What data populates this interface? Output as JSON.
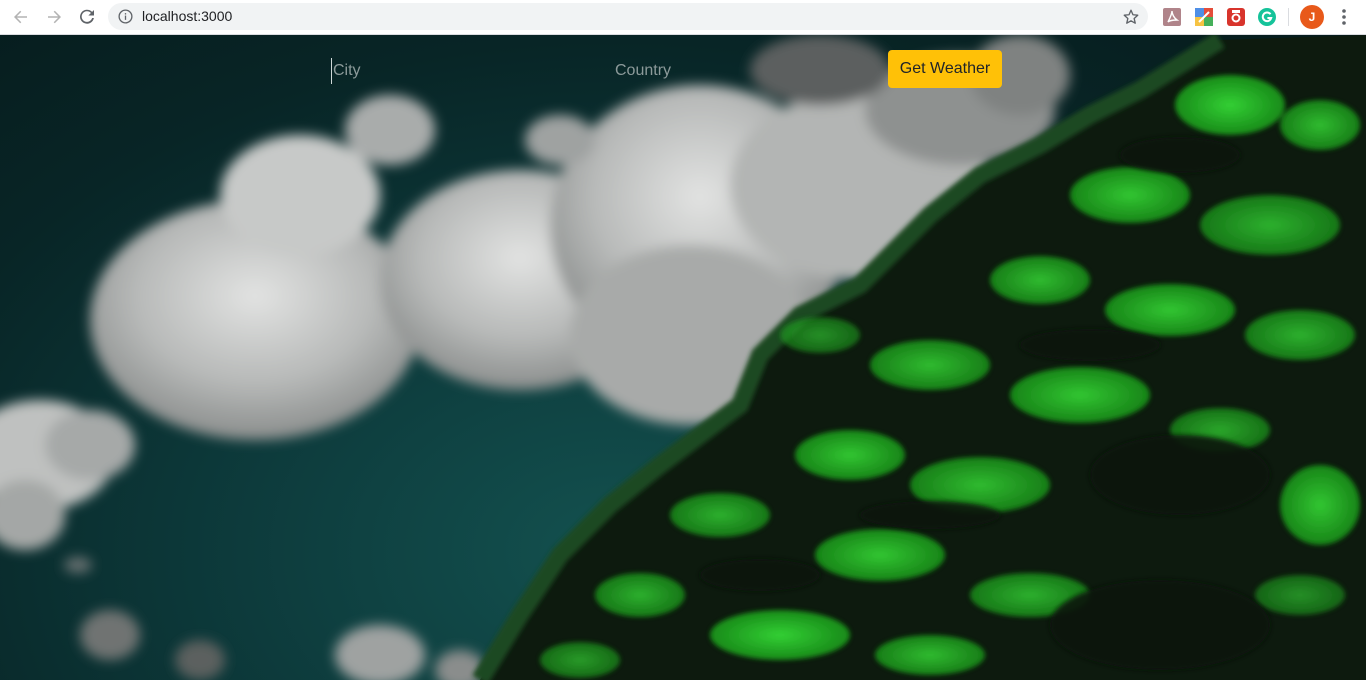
{
  "browser": {
    "url": "localhost:3000",
    "profile_initial": "J",
    "profile_color": "#e8591a",
    "icons": {
      "back": "back-arrow-icon",
      "forward": "forward-arrow-icon",
      "reload": "reload-icon",
      "site_info": "info-icon",
      "bookmark": "star-icon",
      "menu": "more-vert-icon"
    },
    "extensions": [
      {
        "name": "pdf-extension-icon",
        "color": "#b0848a"
      },
      {
        "name": "color-picker-extension-icon",
        "color": "#4f8fe6"
      },
      {
        "name": "screen-capture-extension-icon",
        "color": "#d8342c"
      },
      {
        "name": "grammarly-extension-icon",
        "color": "#15c39a"
      }
    ]
  },
  "form": {
    "city_placeholder": "City",
    "country_placeholder": "Country",
    "submit_label": "Get Weather",
    "submit_color": "#ffc107"
  },
  "background": {
    "description_colors": {
      "sky": "#0d3b3c",
      "cloud": "#c9cbca",
      "foliage_dark": "#0f1a10",
      "foliage_bright": "#2bd42b"
    }
  }
}
